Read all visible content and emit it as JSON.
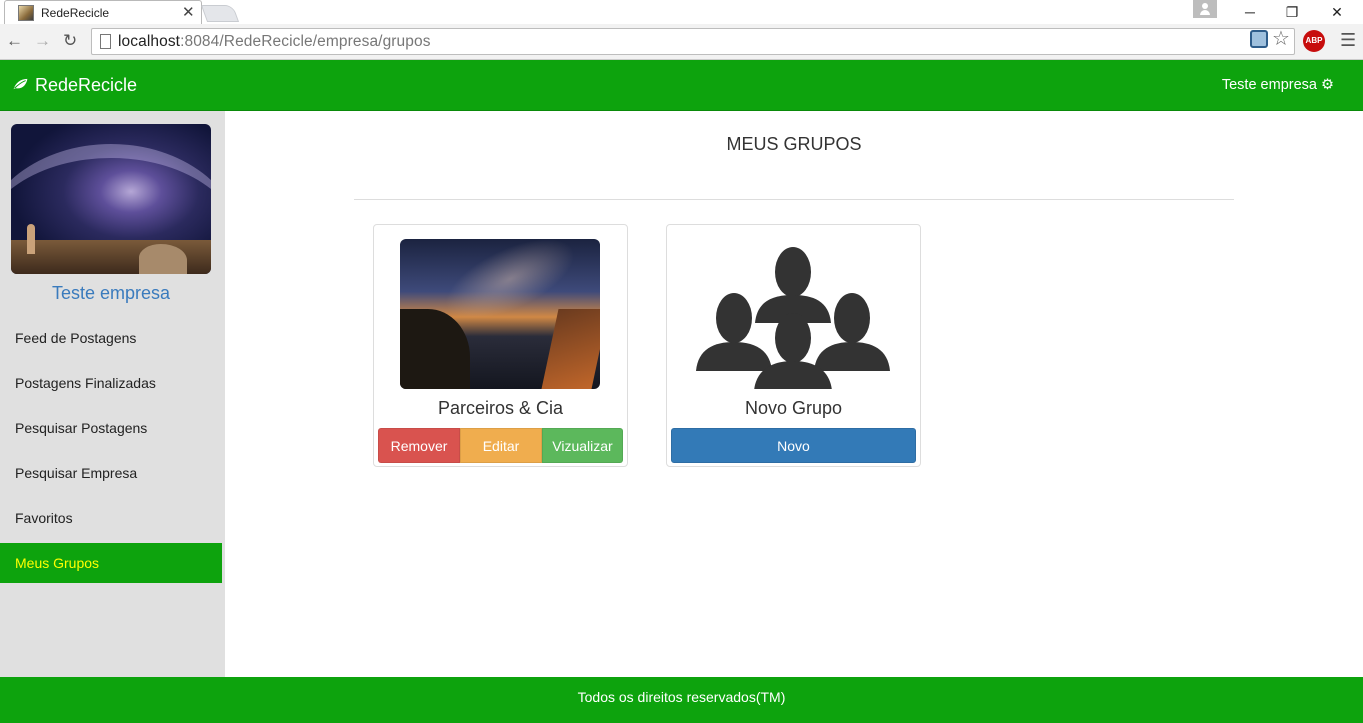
{
  "browser": {
    "tab_title": "RedeRecicle",
    "url_host": "localhost",
    "url_rest": ":8084/RedeRecicle/empresa/grupos",
    "abp_label": "ABP"
  },
  "navbar": {
    "brand": "RedeRecicle",
    "user": "Teste empresa"
  },
  "sidebar": {
    "company_name": "Teste empresa",
    "items": [
      {
        "label": "Feed de Postagens"
      },
      {
        "label": "Postagens Finalizadas"
      },
      {
        "label": "Pesquisar Postagens"
      },
      {
        "label": "Pesquisar Empresa"
      },
      {
        "label": "Favoritos"
      },
      {
        "label": "Meus Grupos"
      }
    ]
  },
  "main": {
    "title": "MEUS GRUPOS",
    "groups": [
      {
        "name": "Parceiros & Cia",
        "remove_label": "Remover",
        "edit_label": "Editar",
        "view_label": "Vizualizar"
      }
    ],
    "new_group": {
      "name": "Novo Grupo",
      "button_label": "Novo"
    }
  },
  "footer": {
    "text": "Todos os direitos reservados(TM)"
  },
  "colors": {
    "brand_green": "#0da30d",
    "active_text": "#ffff00",
    "remove": "#d9534f",
    "edit": "#f0ad4e",
    "view": "#5cb85c",
    "new": "#337ab7"
  }
}
